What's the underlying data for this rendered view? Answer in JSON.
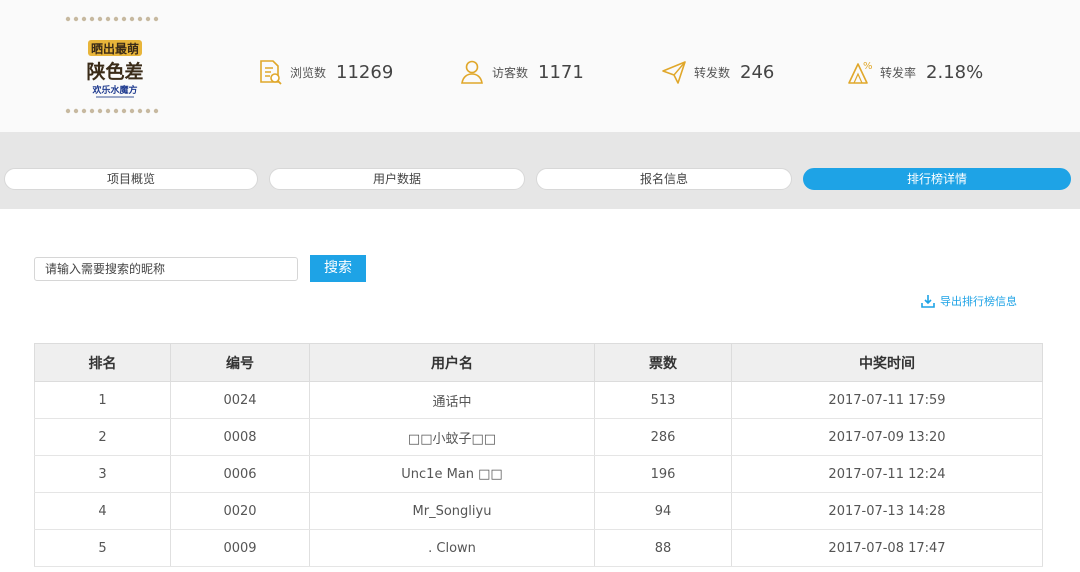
{
  "header": {
    "logo": {
      "lines": [
        "晒出最萌",
        "陕色差",
        "欢乐水魔方"
      ],
      "colors": {
        "gold": "#d89a1e",
        "dark": "#3a2b18",
        "navy": "#1f3b8f"
      }
    },
    "stats": [
      {
        "icon": "document-eye-icon",
        "label": "浏览数",
        "value": "11269"
      },
      {
        "icon": "user-icon",
        "label": "访客数",
        "value": "1171"
      },
      {
        "icon": "paper-plane-icon",
        "label": "转发数",
        "value": "246"
      },
      {
        "icon": "percent-rate-icon",
        "label": "转发率",
        "value": "2.18%"
      }
    ],
    "icon_color": "#e0a72a"
  },
  "tabs": [
    {
      "label": "项目概览",
      "active": false
    },
    {
      "label": "用户数据",
      "active": false
    },
    {
      "label": "报名信息",
      "active": false
    },
    {
      "label": "排行榜详情",
      "active": true
    }
  ],
  "search": {
    "placeholder": "请输入需要搜索的昵称",
    "button_label": "搜索"
  },
  "export": {
    "icon": "download-icon",
    "label": "导出排行榜信息"
  },
  "table": {
    "headers": [
      "排名",
      "编号",
      "用户名",
      "票数",
      "中奖时间"
    ],
    "rows": [
      [
        "1",
        "0024",
        "通话中",
        "513",
        "2017-07-11 17:59"
      ],
      [
        "2",
        "0008",
        "□□小蚊子□□",
        "286",
        "2017-07-09 13:20"
      ],
      [
        "3",
        "0006",
        "Unc1e Man □□",
        "196",
        "2017-07-11 12:24"
      ],
      [
        "4",
        "0020",
        "Mr_Songliyu",
        "94",
        "2017-07-13 14:28"
      ],
      [
        "5",
        "0009",
        ". Clown",
        "88",
        "2017-07-08 17:47"
      ]
    ]
  },
  "accent_color": "#1ea3e6"
}
